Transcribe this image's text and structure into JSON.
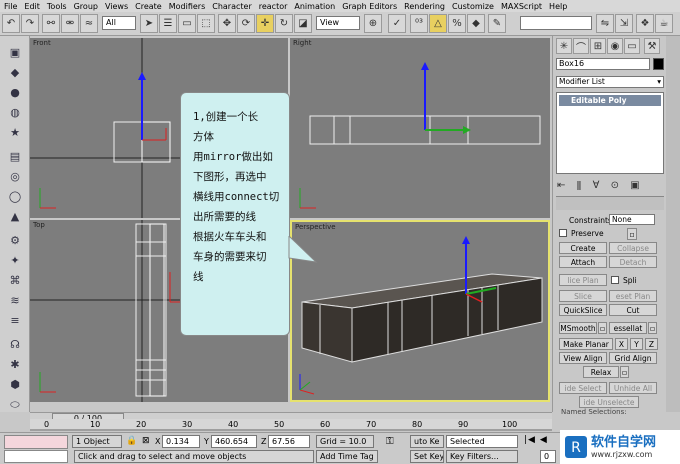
{
  "menu": [
    "File",
    "Edit",
    "Tools",
    "Group",
    "Views",
    "Create",
    "Modifiers",
    "Character",
    "reactor",
    "Animation",
    "Graph Editors",
    "Rendering",
    "Customize",
    "MAXScript",
    "Help"
  ],
  "toolbar": {
    "selection_filter": "All",
    "coord_system": "View"
  },
  "viewports": {
    "front": "Front",
    "right": "Right",
    "top": "Top",
    "perspective": "Perspective"
  },
  "callout": {
    "lines": [
      "1,创建一个长",
      "方体",
      "用mirror做出如",
      "下图形，再选中",
      "横线用connect切",
      "出所需要的线",
      "根据火车车头和",
      "车身的需要来切",
      "线"
    ]
  },
  "panel": {
    "object_name": "Box16",
    "modifier_list": "Modifier List",
    "stack_item": "Editable Poly",
    "constraints_label": "Constraints:",
    "constraints_value": "None",
    "preserve": "Preserve",
    "create": "Create",
    "collapse": "Collapse",
    "attach": "Attach",
    "detach": "Detach",
    "slice_plane": "lice Plan",
    "split": "Spli",
    "slice": "Slice",
    "reset_plane": "eset Plan",
    "quickslice": "QuickSlice",
    "cut": "Cut",
    "msmooth": "MSmooth",
    "tessellate": "essellat",
    "make_planar": "Make Planar",
    "x": "X",
    "y": "Y",
    "z": "Z",
    "view_align": "View Align",
    "grid_align": "Grid Align",
    "relax": "Relax",
    "hide_selected": "ide Select",
    "unhide_all": "Unhide All",
    "hide_unselected": "ide Unselecte",
    "named_selections": "Named Selections:"
  },
  "timeline": {
    "frame": "0 / 100",
    "ticks": [
      "0",
      "10",
      "20",
      "30",
      "40",
      "50",
      "60",
      "70",
      "80",
      "90",
      "100"
    ]
  },
  "status": {
    "objects": "1 Object",
    "x_label": "X",
    "x": "0.134",
    "y_label": "Y",
    "y": "460.654",
    "z_label": "Z",
    "z": "67.56",
    "grid": "Grid = 10.0",
    "prompt": "Click and drag to select and move objects",
    "add_time_tag": "Add Time Tag",
    "auto_key": "uto Ke",
    "set_key": "Set Key",
    "selected": "Selected",
    "key_filters": "Key Filters...",
    "frame_num": "0"
  },
  "watermark": {
    "brand": "软件自学网",
    "url": "www.rjzxw.com"
  },
  "colors": {
    "viewport": "#7d7d7d",
    "callout": "#cff0f0",
    "active_border": "#e6e26e",
    "box_dark": "#3a3530"
  }
}
